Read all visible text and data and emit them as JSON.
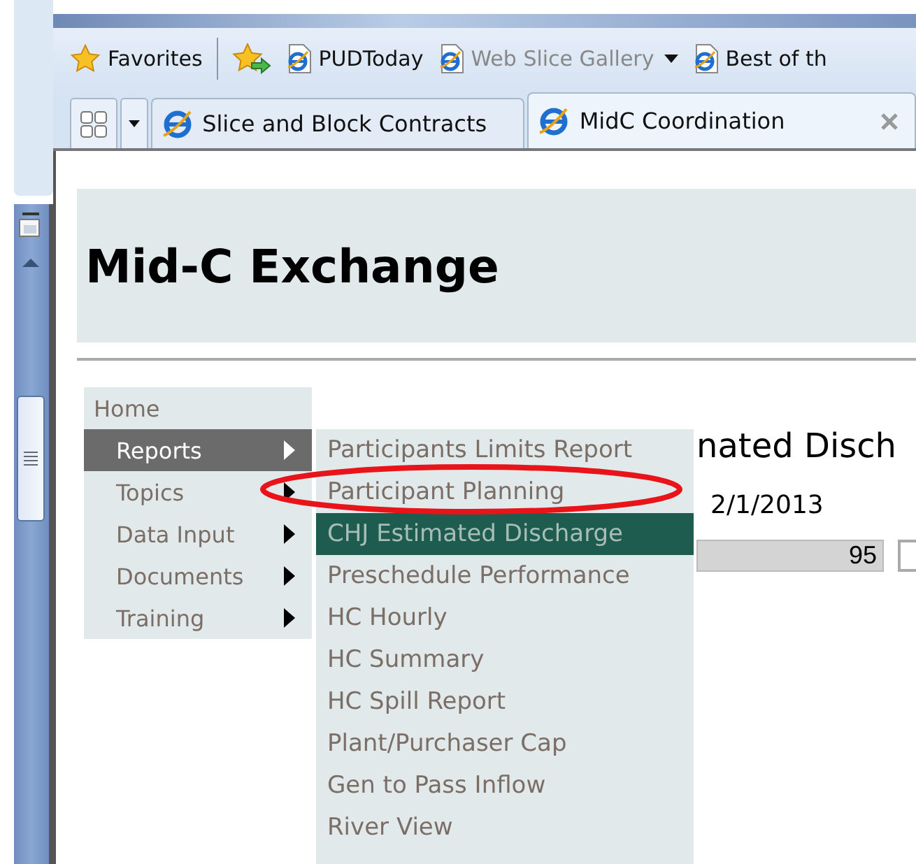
{
  "favorites_bar": {
    "label": "Favorites",
    "links": [
      {
        "label": "PUDToday",
        "greyed": false,
        "has_menu": false
      },
      {
        "label": "Web Slice Gallery",
        "greyed": true,
        "has_menu": true
      },
      {
        "label": "Best of th",
        "greyed": false,
        "has_menu": false
      }
    ]
  },
  "tabs": [
    {
      "label": "Slice and Block Contracts",
      "selected": false
    },
    {
      "label": "MidC Coordination",
      "selected": true
    }
  ],
  "page": {
    "title": "Mid-C Exchange",
    "menu": [
      {
        "label": "Home",
        "selected": false,
        "has_submenu": false
      },
      {
        "label": "Reports",
        "selected": true,
        "has_submenu": true
      },
      {
        "label": "Topics",
        "selected": false,
        "has_submenu": true
      },
      {
        "label": "Data Input",
        "selected": false,
        "has_submenu": true
      },
      {
        "label": "Documents",
        "selected": false,
        "has_submenu": true
      },
      {
        "label": "Training",
        "selected": false,
        "has_submenu": true
      }
    ],
    "submenu": [
      {
        "label": "Participants Limits Report",
        "selected": false
      },
      {
        "label": "Participant Planning",
        "selected": false
      },
      {
        "label": "CHJ Estimated Discharge",
        "selected": true
      },
      {
        "label": "Preschedule Performance",
        "selected": false
      },
      {
        "label": "HC Hourly",
        "selected": false
      },
      {
        "label": "HC Summary",
        "selected": false
      },
      {
        "label": "HC Spill Report",
        "selected": false
      },
      {
        "label": "Plant/Purchaser Cap",
        "selected": false
      },
      {
        "label": "Gen to Pass Inflow",
        "selected": false
      },
      {
        "label": "River View",
        "selected": false
      }
    ],
    "report_title": "nated Disch",
    "date": "2/1/2013",
    "field_value": "95"
  }
}
